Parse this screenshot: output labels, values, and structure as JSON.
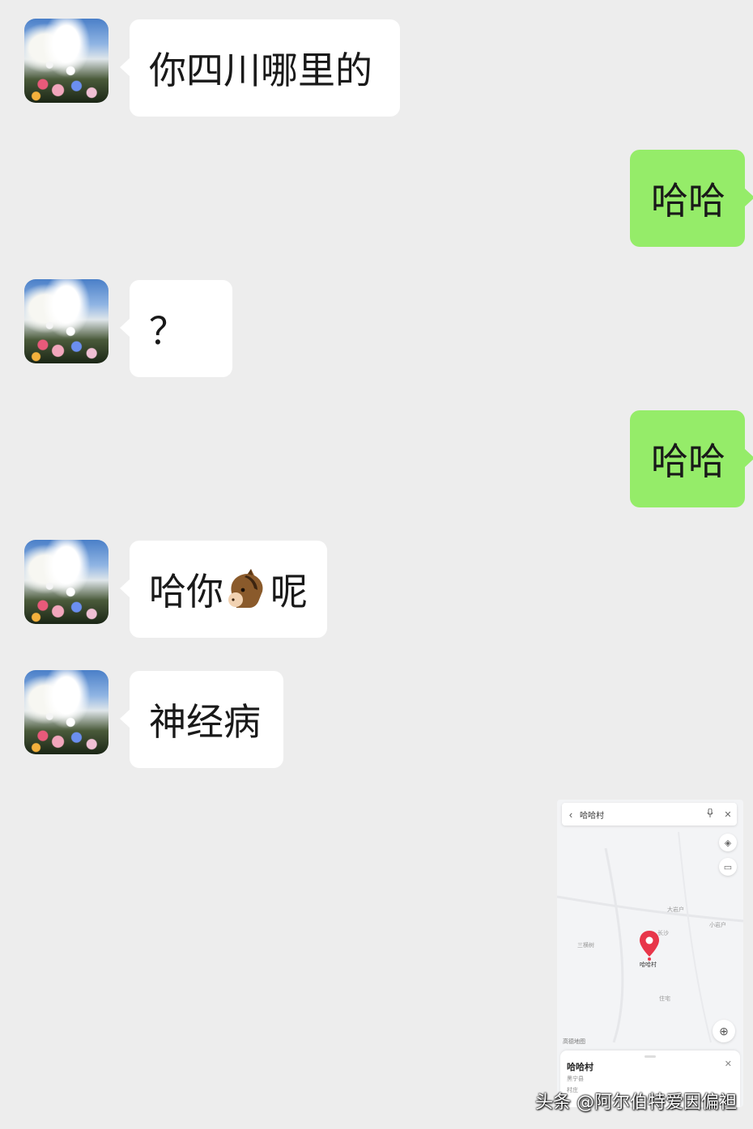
{
  "messages": [
    {
      "side": "left",
      "text": "你四川哪里的"
    },
    {
      "side": "right",
      "text": "哈哈"
    },
    {
      "side": "left",
      "text": "？"
    },
    {
      "side": "right",
      "text": "哈哈"
    },
    {
      "side": "left",
      "text_before": "哈你",
      "emoji": "horse-face-icon",
      "text_after": "呢"
    },
    {
      "side": "left",
      "text": "神经病"
    }
  ],
  "map": {
    "search_query": "哈哈村",
    "places": {
      "dayanhu": "大岩户",
      "xiaoyanhu": "小岩户",
      "sanheng": "三横树",
      "changsha": "长沙",
      "zhaijia": "住宅"
    },
    "pin_label": "哈哈村",
    "brand": "高德地图",
    "card": {
      "title": "哈哈村",
      "line1": "黑宁县",
      "line2": "村庄"
    }
  },
  "watermark": "头条 @阿尔伯特爱因偏袒",
  "colors": {
    "background": "#ededed",
    "bubble_received": "#ffffff",
    "bubble_sent": "#95ec69",
    "pin_red": "#e8364a"
  }
}
